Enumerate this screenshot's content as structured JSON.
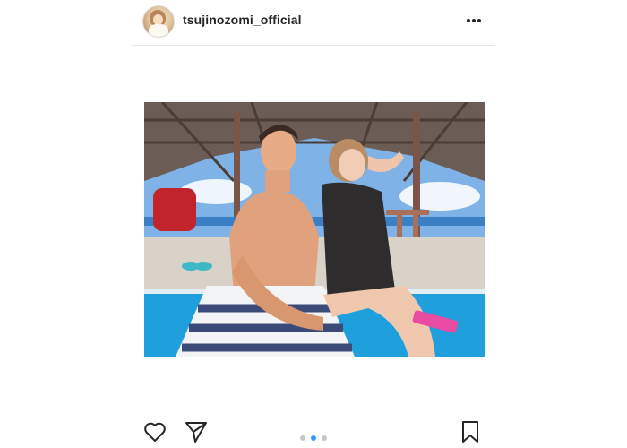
{
  "header": {
    "username": "tsujinozomi_official",
    "avatar_icon": "profile-avatar",
    "more_icon": "more-horizontal-icon"
  },
  "photo": {
    "description_icon": "post-photo"
  },
  "actions": {
    "like_icon": "heart-icon",
    "share_icon": "paper-plane-icon",
    "save_icon": "bookmark-icon"
  },
  "carousel": {
    "total": 3,
    "active_index": 1
  },
  "colors": {
    "text": "#262626",
    "divider": "#e6e6e6",
    "active_dot": "#3897f0",
    "inactive_dot": "#c7c7c7"
  }
}
